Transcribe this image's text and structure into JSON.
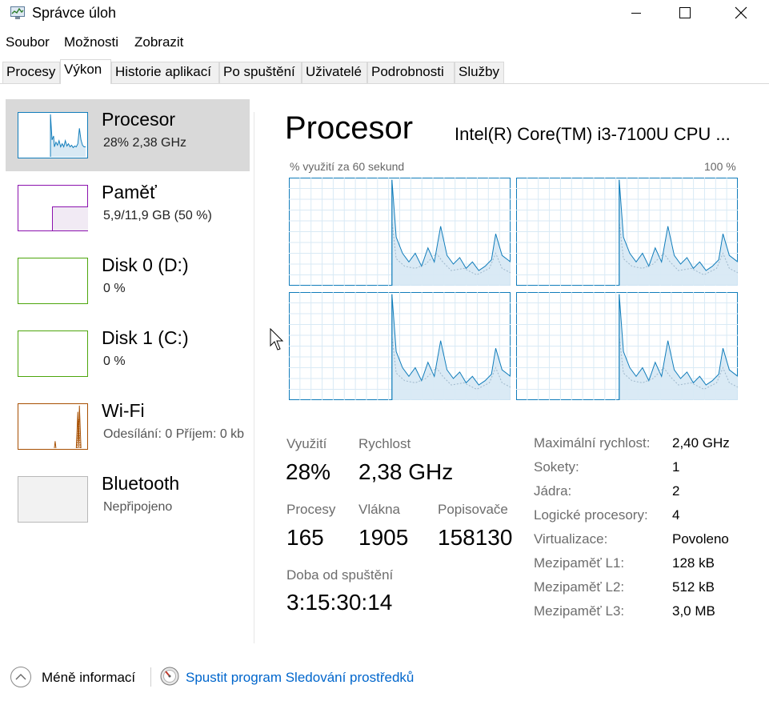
{
  "window": {
    "title": "Správce úloh"
  },
  "menu": [
    "Soubor",
    "Možnosti",
    "Zobrazit"
  ],
  "tabs": [
    "Procesy",
    "Výkon",
    "Historie aplikací",
    "Po spuštění",
    "Uživatelé",
    "Podrobnosti",
    "Služby"
  ],
  "active_tab": "Výkon",
  "sidebar": {
    "items": [
      {
        "name": "Procesor",
        "sub": "28%  2,38 GHz",
        "color": "#117dbb",
        "selected": true
      },
      {
        "name": "Paměť",
        "sub": "5,9/11,9 GB (50 %)",
        "color": "#8b12ae",
        "fill_fraction": 0.5
      },
      {
        "name": "Disk 0 (D:)",
        "sub": "0 %",
        "color": "#4da60c"
      },
      {
        "name": "Disk 1 (C:)",
        "sub": "0 %",
        "color": "#4da60c"
      },
      {
        "name": "Wi-Fi",
        "sub": "Odesílání:  0  Příjem:  0 kb",
        "color": "#a74f01"
      },
      {
        "name": "Bluetooth",
        "sub": "Nepřipojeno",
        "color": "#8a8a8a"
      }
    ]
  },
  "main": {
    "title": "Procesor",
    "model": "Intel(R) Core(TM) i3-7100U CPU ...",
    "graph_caption": "% využití za 60 sekund",
    "graph_max": "100 %",
    "accent": "#117dbb",
    "stats": {
      "utilization_label": "Využití",
      "utilization_value": "28%",
      "speed_label": "Rychlost",
      "speed_value": "2,38 GHz",
      "processes_label": "Procesy",
      "processes_value": "165",
      "threads_label": "Vlákna",
      "threads_value": "1905",
      "handles_label": "Popisovače",
      "handles_value": "158130",
      "uptime_label": "Doba od spuštění",
      "uptime_value": "3:15:30:14"
    },
    "specs": [
      {
        "label": "Maximální rychlost:",
        "value": "2,40 GHz"
      },
      {
        "label": "Sokety:",
        "value": "1"
      },
      {
        "label": "Jádra:",
        "value": "2"
      },
      {
        "label": "Logické procesory:",
        "value": "4"
      },
      {
        "label": "Virtualizace:",
        "value": "Povoleno"
      },
      {
        "label": "Mezipaměť L1:",
        "value": "128 kB"
      },
      {
        "label": "Mezipaměť L2:",
        "value": "512 kB"
      },
      {
        "label": "Mezipaměť L3:",
        "value": "3,0 MB"
      }
    ]
  },
  "footer": {
    "less_info": "Méně informací",
    "resource_monitor_link": "Spustit program Sledování prostředků"
  }
}
